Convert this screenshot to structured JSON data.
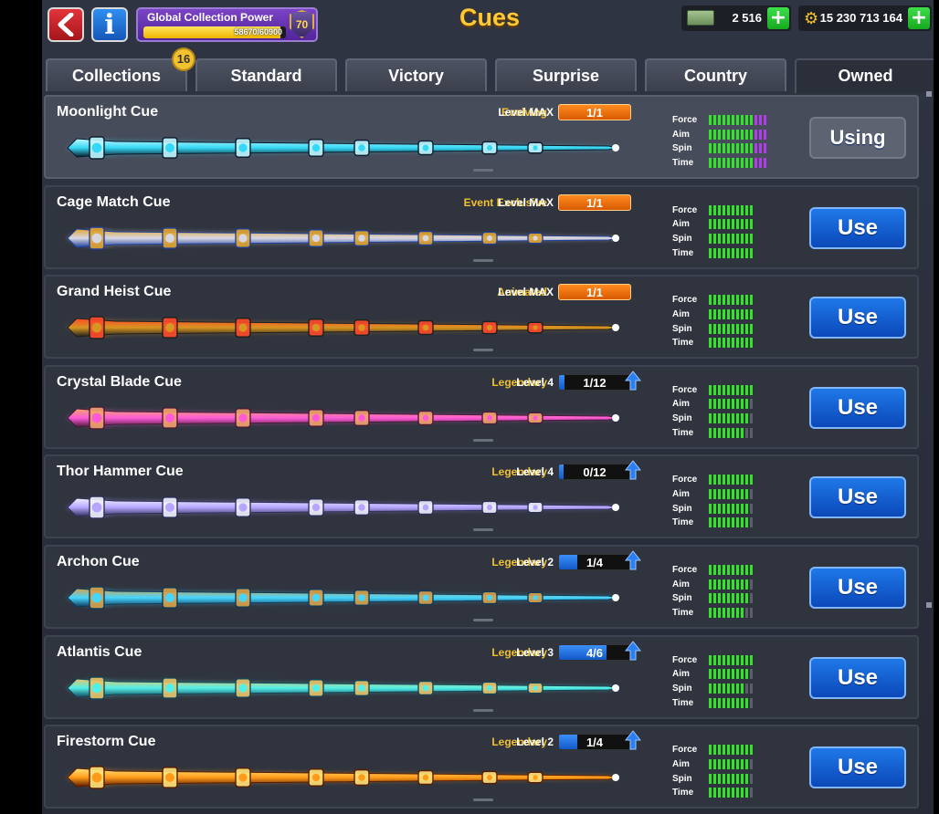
{
  "header": {
    "title": "Cues",
    "back_icon": "arrow-left-icon",
    "info_label": "i",
    "power": {
      "title": "Global Collection Power",
      "value": "58670/60900",
      "progress": 0.963,
      "level": "70"
    },
    "cash": {
      "icon": "cash-icon",
      "value": "2 516"
    },
    "coins": {
      "icon": "coins-icon",
      "value": "15 230 713 164"
    },
    "plus_label": "+"
  },
  "tabs": [
    {
      "label": "Collections",
      "badge": "16"
    },
    {
      "label": "Standard"
    },
    {
      "label": "Victory"
    },
    {
      "label": "Surprise"
    },
    {
      "label": "Country"
    },
    {
      "label": "Owned",
      "active": true
    }
  ],
  "stat_labels": [
    "Force",
    "Aim",
    "Spin",
    "Time"
  ],
  "cues": [
    {
      "name": "Moonlight Cue",
      "tag": "Evolving",
      "level": "Level MAX",
      "progress": "1/1",
      "max": true,
      "button": "Using",
      "selected": true,
      "stats": [
        [
          10,
          3
        ],
        [
          10,
          3
        ],
        [
          10,
          3
        ],
        [
          10,
          3
        ]
      ],
      "colors": [
        "#0b1a2b",
        "#35d8f5",
        "#bff6ff"
      ]
    },
    {
      "name": "Cage Match Cue",
      "tag": "Event Exclusive",
      "level": "Level MAX",
      "progress": "1/1",
      "max": true,
      "button": "Use",
      "stats": [
        [
          10,
          0
        ],
        [
          10,
          0
        ],
        [
          10,
          0
        ],
        [
          10,
          0
        ]
      ],
      "colors": [
        "#1f3f9a",
        "#d7d7e4",
        "#e2a632"
      ]
    },
    {
      "name": "Grand Heist Cue",
      "tag": "Animated",
      "level": "Level MAX",
      "progress": "1/1",
      "max": true,
      "button": "Use",
      "stats": [
        [
          10,
          0
        ],
        [
          10,
          0
        ],
        [
          10,
          0
        ],
        [
          10,
          0
        ]
      ],
      "colors": [
        "#1e1e1e",
        "#d79521",
        "#ff4a2a"
      ]
    },
    {
      "name": "Crystal Blade Cue",
      "tag": "Legendary",
      "level": "Level 4",
      "progress": "1/12",
      "fill": 0.083,
      "button": "Use",
      "stats": [
        [
          10,
          0
        ],
        [
          9,
          0
        ],
        [
          9,
          0
        ],
        [
          8,
          0
        ]
      ],
      "colors": [
        "#4a1a3a",
        "#ff5bd8",
        "#f3a36b"
      ]
    },
    {
      "name": "Thor Hammer Cue",
      "tag": "Legendary",
      "level": "Level 4",
      "progress": "0/12",
      "fill": 0,
      "button": "Use",
      "stats": [
        [
          10,
          0
        ],
        [
          9,
          0
        ],
        [
          9,
          0
        ],
        [
          9,
          0
        ]
      ],
      "colors": [
        "#2c2f58",
        "#b7a6ff",
        "#f0f0ff"
      ]
    },
    {
      "name": "Archon Cue",
      "tag": "Legendary",
      "level": "Level 2",
      "progress": "1/4",
      "fill": 0.25,
      "button": "Use",
      "stats": [
        [
          10,
          0
        ],
        [
          9,
          0
        ],
        [
          9,
          0
        ],
        [
          8,
          0
        ]
      ],
      "colors": [
        "#0f3a5a",
        "#46d6ff",
        "#d8a24a"
      ]
    },
    {
      "name": "Atlantis Cue",
      "tag": "Legendary",
      "level": "Level 3",
      "progress": "4/6",
      "fill": 0.667,
      "button": "Use",
      "stats": [
        [
          10,
          0
        ],
        [
          9,
          0
        ],
        [
          8,
          0
        ],
        [
          9,
          0
        ]
      ],
      "colors": [
        "#12465a",
        "#52f0e8",
        "#e8c46a"
      ]
    },
    {
      "name": "Firestorm Cue",
      "tag": "Legendary",
      "level": "Level 2",
      "progress": "1/4",
      "fill": 0.25,
      "button": "Use",
      "stats": [
        [
          10,
          0
        ],
        [
          9,
          0
        ],
        [
          9,
          0
        ],
        [
          9,
          0
        ]
      ],
      "colors": [
        "#5a1c00",
        "#ff9b1a",
        "#ffe37a"
      ]
    }
  ]
}
